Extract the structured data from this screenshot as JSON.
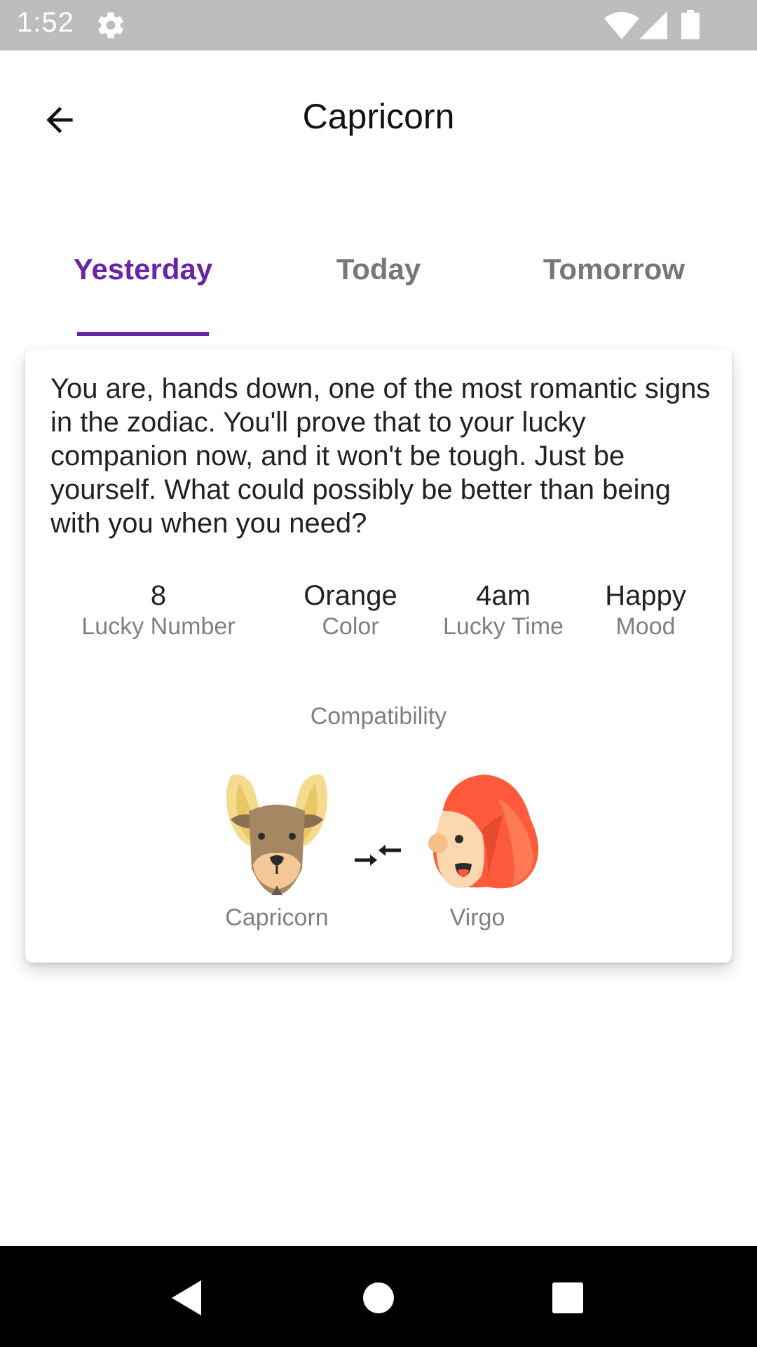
{
  "status_bar": {
    "time": "1:52",
    "icons": [
      "gear-icon",
      "wifi-icon",
      "signal-icon",
      "battery-icon"
    ]
  },
  "app_bar": {
    "title": "Capricorn",
    "back_icon": "arrow-left-icon"
  },
  "tabs": [
    {
      "label": "Yesterday",
      "active": true
    },
    {
      "label": "Today",
      "active": false
    },
    {
      "label": "Tomorrow",
      "active": false
    }
  ],
  "card": {
    "description": "You are, hands down, one of the most romantic signs in the zodiac. You'll prove that to your lucky companion now, and it won't be tough. Just be yourself. What could possibly be better than being with you when you need?",
    "stats": [
      {
        "value": "8",
        "label": "Lucky Number"
      },
      {
        "value": "Orange",
        "label": "Color"
      },
      {
        "value": "4am",
        "label": "Lucky Time"
      },
      {
        "value": "Happy",
        "label": "Mood"
      }
    ],
    "compatibility": {
      "title": "Compatibility",
      "sign_a": {
        "name": "Capricorn",
        "icon": "goat-icon"
      },
      "sign_b": {
        "name": "Virgo",
        "icon": "woman-face-icon"
      },
      "connector_icon": "compare-arrows-icon"
    }
  },
  "colors": {
    "accent": "#6a24a6",
    "status_bar": "#bdbdbd",
    "inactive_tab": "#777777"
  },
  "nav_bar": {
    "icons": [
      "back-triangle-icon",
      "home-circle-icon",
      "recents-square-icon"
    ]
  }
}
